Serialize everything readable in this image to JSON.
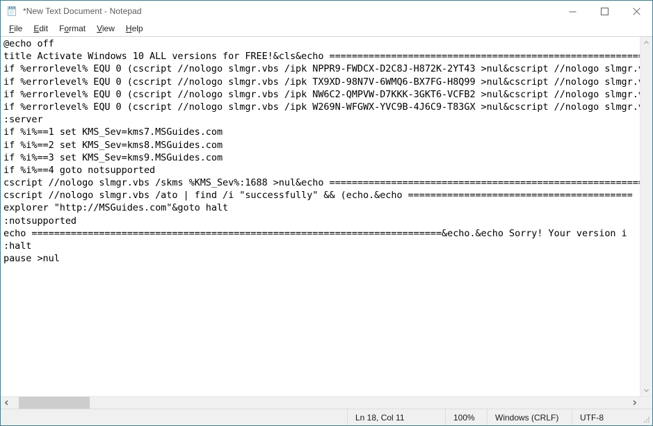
{
  "window": {
    "title": "*New Text Document - Notepad",
    "icon": "notepad-icon",
    "border_color": "#3f7f8c",
    "caption": {
      "minimize_label": "Minimize",
      "maximize_label": "Maximize",
      "close_label": "Close"
    }
  },
  "menu": {
    "items": [
      {
        "label": "File",
        "access_key": "F",
        "before": "",
        "after": "ile"
      },
      {
        "label": "Edit",
        "access_key": "E",
        "before": "",
        "after": "dit"
      },
      {
        "label": "Format",
        "access_key": "o",
        "before": "F",
        "after": "rmat"
      },
      {
        "label": "View",
        "access_key": "V",
        "before": "",
        "after": "iew"
      },
      {
        "label": "Help",
        "access_key": "H",
        "before": "",
        "after": "elp"
      }
    ]
  },
  "editor": {
    "font": "Consolas-like monospace",
    "text_color": "#000000",
    "background_color": "#ffffff",
    "lines": [
      "@echo off",
      "title Activate Windows 10 ALL versions for FREE!&cls&echo ============================================================================",
      "if %errorlevel% EQU 0 (cscript //nologo slmgr.vbs /ipk NPPR9-FWDCX-D2C8J-H872K-2YT43 >nul&cscript //nologo slmgr.v",
      "if %errorlevel% EQU 0 (cscript //nologo slmgr.vbs /ipk TX9XD-98N7V-6WMQ6-BX7FG-H8Q99 >nul&cscript //nologo slmgr.v",
      "if %errorlevel% EQU 0 (cscript //nologo slmgr.vbs /ipk NW6C2-QMPVW-D7KKK-3GKT6-VCFB2 >nul&cscript //nologo slmgr.v",
      "if %errorlevel% EQU 0 (cscript //nologo slmgr.vbs /ipk W269N-WFGWX-YVC9B-4J6C9-T83GX >nul&cscript //nologo slmgr.v",
      ":server",
      "if %i%==1 set KMS_Sev=kms7.MSGuides.com",
      "if %i%==2 set KMS_Sev=kms8.MSGuides.com",
      "if %i%==3 set KMS_Sev=kms9.MSGuides.com",
      "if %i%==4 goto notsupported",
      "cscript //nologo slmgr.vbs /skms %KMS_Sev%:1688 >nul&echo =========================================================",
      "cscript //nologo slmgr.vbs /ato | find /i \"successfully\" && (echo.&echo ========================================",
      "explorer \"http://MSGuides.com\"&goto halt",
      ":notsupported",
      "echo =========================================================================&echo.&echo Sorry! Your version i",
      ":halt",
      "pause >nul"
    ]
  },
  "scrollbars": {
    "vertical": {
      "up_arrow": "chevron-up-icon",
      "down_arrow": "chevron-down-icon",
      "thumb_visible": false
    },
    "horizontal": {
      "left_arrow": "chevron-left-icon",
      "right_arrow": "chevron-right-icon",
      "thumb_visible": true
    }
  },
  "status_bar": {
    "cursor_position": "Ln 18, Col 11",
    "zoom": "100%",
    "line_ending": "Windows (CRLF)",
    "encoding": "UTF-8",
    "grip": "resize-grip-icon"
  }
}
